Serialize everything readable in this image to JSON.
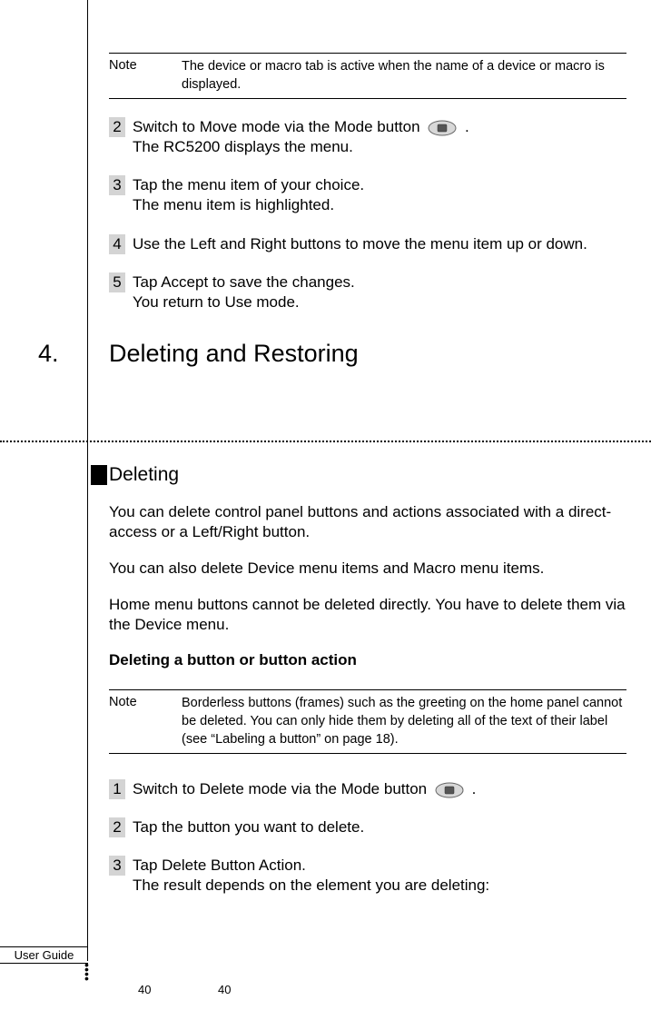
{
  "note1": {
    "label": "Note",
    "text": "The device or macro tab is active when the name of a device or macro is displayed."
  },
  "steps_top": [
    {
      "num": "2",
      "line1_pre": "Switch to Move mode via the Mode button ",
      "line1_post": " .",
      "line2": "The RC5200 displays the menu.",
      "has_icon": true
    },
    {
      "num": "3",
      "line1_pre": "Tap the menu item of your choice.",
      "line1_post": "",
      "line2": "The menu item is highlighted.",
      "has_icon": false
    },
    {
      "num": "4",
      "line1_pre": "Use the Left and Right buttons to move the menu item up or down.",
      "line1_post": "",
      "line2": "",
      "has_icon": false
    },
    {
      "num": "5",
      "line1_pre": "Tap Accept to save the changes.",
      "line1_post": "",
      "line2": "You return to Use mode.",
      "has_icon": false
    }
  ],
  "section": {
    "number": "4.",
    "title": "Deleting and Restoring"
  },
  "subsection": {
    "title": "Deleting"
  },
  "paras": [
    "You can delete control panel buttons and actions associated with a direct-access or a Left/Right button.",
    "You can also delete Device menu items and Macro menu items.",
    "Home menu buttons cannot be deleted directly. You have to delete them via the Device menu."
  ],
  "bold_heading": "Deleting a button or button action",
  "note2": {
    "label": "Note",
    "text": "Borderless buttons (frames) such as the greeting on the home panel cannot be deleted. You can only hide them by deleting all of the text of their label (see “Labeling a button” on page 18)."
  },
  "steps_bottom": [
    {
      "num": "1",
      "line1_pre": "Switch to Delete mode via the Mode button ",
      "line1_post": " .",
      "line2": "",
      "has_icon": true
    },
    {
      "num": "2",
      "line1_pre": "Tap the button you want to delete.",
      "line1_post": "",
      "line2": "",
      "has_icon": false
    },
    {
      "num": "3",
      "line1_pre": "Tap Delete Button Action.",
      "line1_post": "",
      "line2": "The result depends on the element you are deleting:",
      "has_icon": false
    }
  ],
  "footer": {
    "label": "User Guide",
    "page1": "40",
    "page2": "40"
  }
}
